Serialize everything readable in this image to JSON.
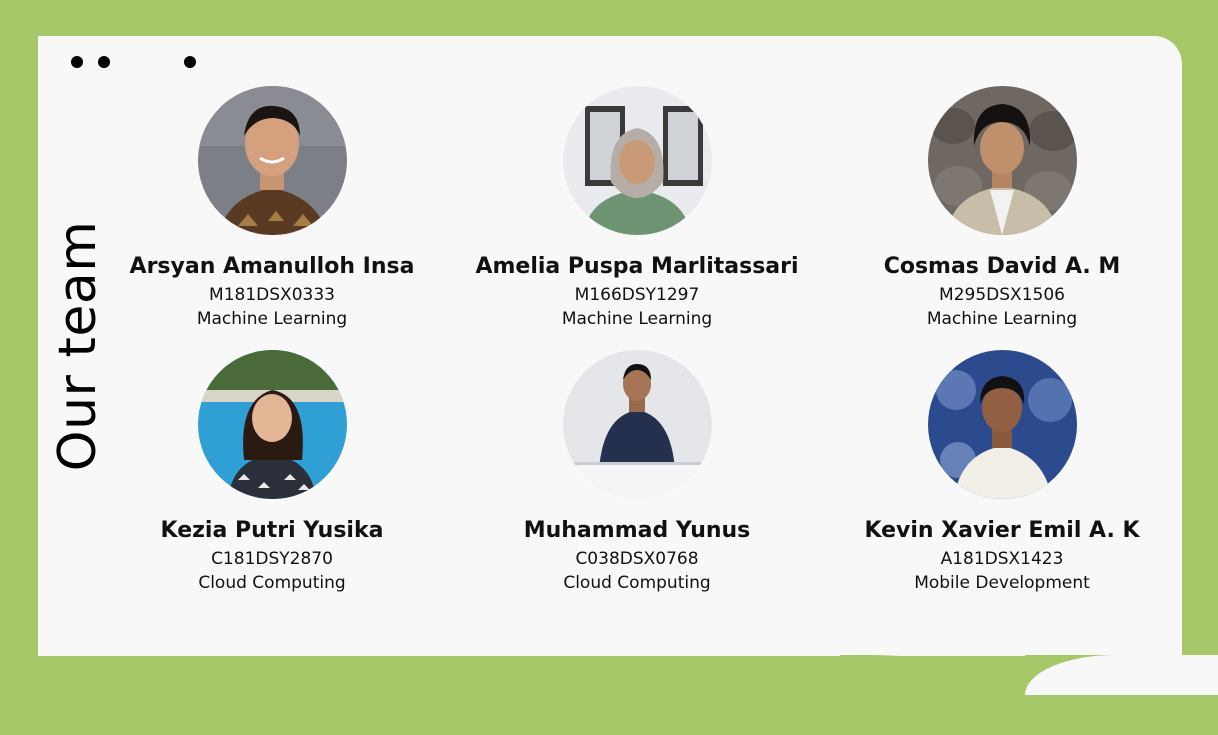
{
  "slide": {
    "title": "Our team"
  },
  "colors": {
    "frame": "#a6c868",
    "card": "#f8f8f8",
    "text": "#111111"
  },
  "members": [
    {
      "name": "Arsyan Amanulloh Insa",
      "code": "M181DSX0333",
      "track": "Machine Learning",
      "photo": "man-batik-shirt-portrait"
    },
    {
      "name": "Amelia Puspa Marlitassari",
      "code": "M166DSY1297",
      "track": "Machine Learning",
      "photo": "woman-hijab-green-shirt-portrait"
    },
    {
      "name": "Cosmas David A. M",
      "code": "M295DSX1506",
      "track": "Machine Learning",
      "photo": "man-blazer-stone-wall-portrait"
    },
    {
      "name": "Kezia Putri Yusika",
      "code": "C181DSY2870",
      "track": "Cloud Computing",
      "photo": "woman-pool-background-portrait"
    },
    {
      "name": "Muhammad Yunus",
      "code": "C038DSX0768",
      "track": "Cloud Computing",
      "photo": "man-navy-sweater-portrait"
    },
    {
      "name": "Kevin Xavier Emil A. K",
      "code": "A181DSX1423",
      "track": "Mobile Development",
      "photo": "man-white-shirt-blue-backdrop-portrait"
    }
  ]
}
